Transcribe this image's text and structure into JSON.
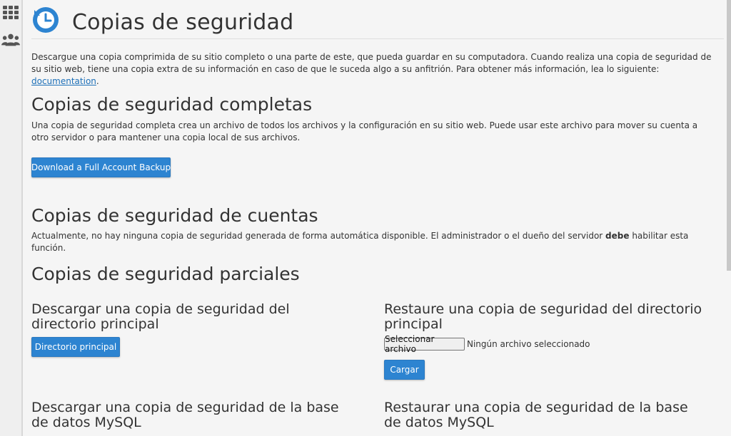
{
  "page": {
    "title": "Copias de seguridad",
    "intro": "Descargue una copia comprimida de su sitio completo o una parte de este, que pueda guardar en su computadora. Cuando realiza una copia de seguridad de su sitio web, tiene una copia extra de su información en caso de que le suceda algo a su anfitrión. Para obtener más información, lea lo siguiente: ",
    "intro_link": "documentation",
    "intro_end": "."
  },
  "full_backup": {
    "heading": "Copias de seguridad completas",
    "description": "Una copia de seguridad completa crea un archivo de todos los archivos y la configuración en su sitio web. Puede usar este archivo para mover su cuenta a otro servidor o para mantener una copia local de sus archivos.",
    "button": "Download a Full Account Backup"
  },
  "account_backups": {
    "heading": "Copias de seguridad de cuentas",
    "text_before": "Actualmente, no hay ninguna copia de seguridad generada de forma automática disponible. El administrador o el dueño del servidor ",
    "text_bold": "debe",
    "text_after": " habilitar esta función."
  },
  "partial": {
    "heading": "Copias de seguridad parciales",
    "home_download": {
      "heading": "Descargar una copia de seguridad del directorio principal",
      "button": "Directorio principal"
    },
    "home_restore": {
      "heading": "Restaure una copia de seguridad del directorio principal",
      "file_button": "Seleccionar archivo",
      "file_status": "Ningún archivo seleccionado",
      "upload_button": "Cargar"
    },
    "mysql_download": {
      "heading": "Descargar una copia de seguridad de la base de datos MySQL"
    },
    "mysql_restore": {
      "heading": "Restaurar una copia de seguridad de la base de datos MySQL"
    }
  },
  "colors": {
    "accent": "#2d84d1",
    "link": "#1d70b8",
    "background": "#f5f5f5"
  },
  "icons": {
    "sidebar": [
      "grid-icon",
      "users-icon"
    ],
    "logo": "backup-clock-icon"
  }
}
